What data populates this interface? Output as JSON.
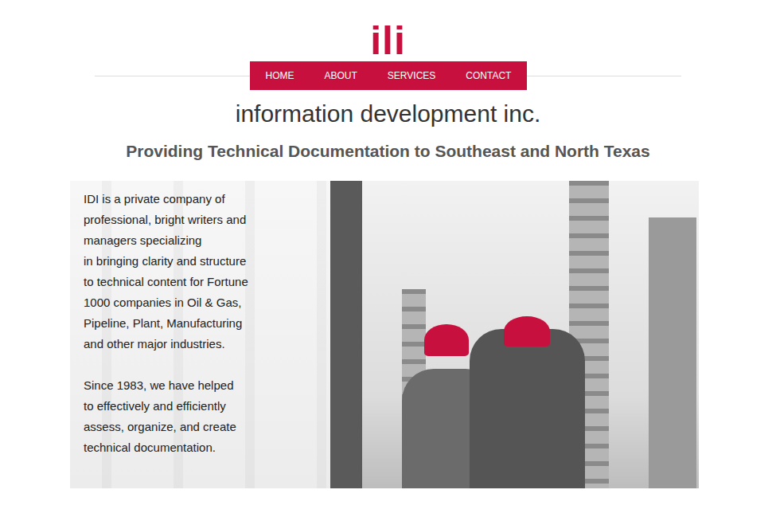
{
  "logo": {
    "text": "ili"
  },
  "nav": {
    "items": [
      {
        "label": "HOME"
      },
      {
        "label": "ABOUT"
      },
      {
        "label": "SERVICES"
      },
      {
        "label": "CONTACT"
      }
    ]
  },
  "company_name": "information development inc.",
  "tagline": "Providing Technical Documentation to Southeast and North Texas",
  "hero": {
    "paragraphs": [
      [
        "IDI is a private company of",
        "professional, bright writers and",
        "managers specializing",
        "in bringing clarity and structure",
        "to technical content for Fortune",
        "1000 companies in Oil & Gas,",
        "Pipeline, Plant, Manufacturing",
        "and other major industries."
      ],
      [
        "Since 1983, we have helped",
        "to effectively and efficiently",
        "assess, organize, and create",
        "technical documentation."
      ]
    ]
  }
}
